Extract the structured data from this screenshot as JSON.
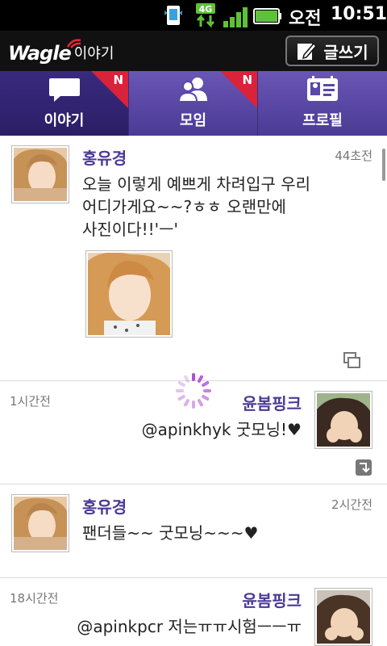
{
  "status_bar": {
    "ampm": "오전",
    "time": "10:51",
    "network": "4G"
  },
  "app_bar": {
    "brand": "Wagle",
    "brand_sub": "이야기",
    "write_label": "글쓰기"
  },
  "tabs": [
    {
      "label": "이야기",
      "active": true,
      "badge": "N"
    },
    {
      "label": "모임",
      "active": false,
      "badge": "N"
    },
    {
      "label": "프로필",
      "active": false,
      "badge": ""
    }
  ],
  "posts": [
    {
      "author": "홍유경",
      "time": "44초전",
      "text": [
        "오늘 이렇게 예쁘게 차려입구 우리",
        "어디가게요~~?ㅎㅎ 오랜만에",
        "사진이다!!'ㅡ'"
      ],
      "has_photo": true
    },
    {
      "author": "윤봄핑크",
      "time": "1시간전",
      "text": [
        "@apinkhyk 굿모닝!♥"
      ]
    },
    {
      "author": "홍유경",
      "time": "2시간전",
      "text": [
        "팬더들~~ 굿모닝~~~♥"
      ]
    },
    {
      "author": "윤봄핑크",
      "time": "18시간전",
      "text": [
        "@apinkpcr 저는ㅠㅠ시험ㅡㅡㅠ"
      ]
    }
  ],
  "colors": {
    "accent": "#4b3a96",
    "tab_bg": "#5a47a8",
    "badge": "#d9233a"
  }
}
